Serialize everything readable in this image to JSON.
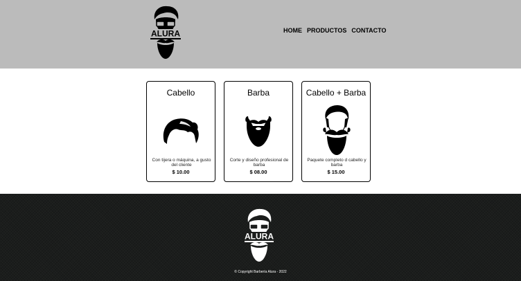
{
  "brand": {
    "logo_text": "ALURA"
  },
  "nav": [
    {
      "label": "HOME"
    },
    {
      "label": "PRODUCTOS"
    },
    {
      "label": "CONTACTO"
    }
  ],
  "products": [
    {
      "title": "Cabello",
      "description": "Con tijera o máquina, a gusto del cliente",
      "price": "$ 10.00",
      "icon": "hair-icon"
    },
    {
      "title": "Barba",
      "description": "Corte y diseño profesional de barba",
      "price": "$ 08.00",
      "icon": "beard-icon"
    },
    {
      "title": "Cabello + Barba",
      "description": "Paquete completo d cabello y barba",
      "price": "$ 15.00",
      "icon": "hair-and-beard-icon"
    }
  ],
  "footer": {
    "copyright": "© Copyright Barbería Alura - 2022"
  },
  "colors": {
    "header_bg": "#bbbbbb",
    "footer_bg": "#1b1d1c",
    "text": "#000000"
  }
}
